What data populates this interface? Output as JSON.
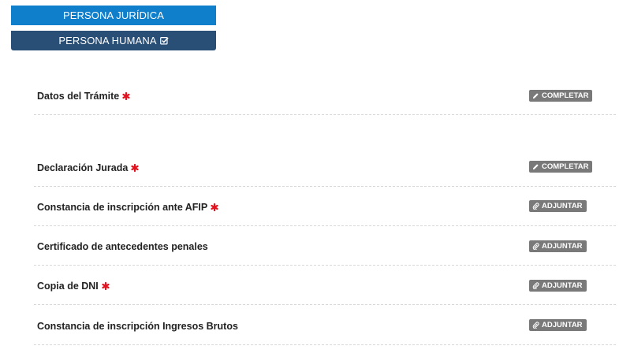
{
  "tabs": {
    "juridica_label": "PERSONA JURÍDICA",
    "humana_label": "PERSONA HUMANA"
  },
  "rows": [
    {
      "label": "Datos del Trámite",
      "required": true,
      "action": "COMPLETAR",
      "action_icon": "pencil-icon"
    },
    {
      "label": "Declaración Jurada",
      "required": true,
      "action": "COMPLETAR",
      "action_icon": "pencil-icon"
    },
    {
      "label": "Constancia de inscripción ante AFIP",
      "required": true,
      "action": "ADJUNTAR",
      "action_icon": "paperclip-icon"
    },
    {
      "label": "Certificado de antecedentes penales",
      "required": false,
      "action": "ADJUNTAR",
      "action_icon": "paperclip-icon"
    },
    {
      "label": "Copia de DNI",
      "required": true,
      "action": "ADJUNTAR",
      "action_icon": "paperclip-icon"
    },
    {
      "label": "Constancia de inscripción Ingresos Brutos",
      "required": false,
      "action": "ADJUNTAR",
      "action_icon": "paperclip-icon"
    }
  ],
  "colors": {
    "tab_active": "#0f7ecb",
    "tab_selected": "#2a4f77",
    "required_marker": "#e3121e",
    "action_badge": "#797979"
  }
}
